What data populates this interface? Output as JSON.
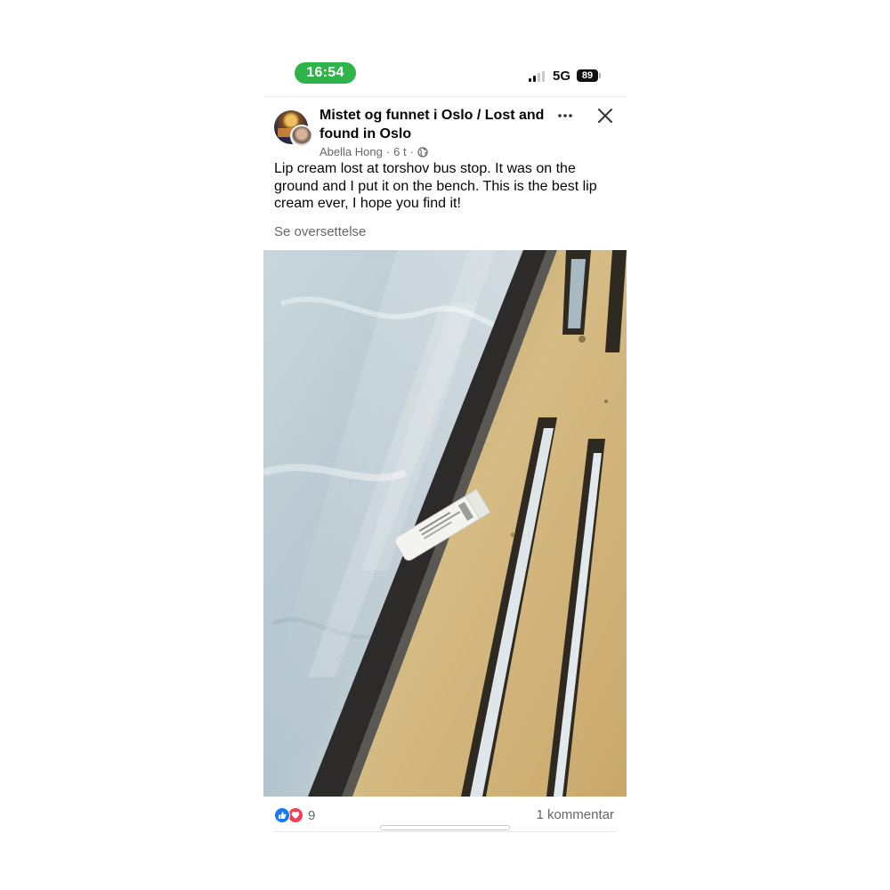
{
  "status_bar": {
    "time": "16:54",
    "network": "5G",
    "battery": "89"
  },
  "post": {
    "group_name": "Mistet og funnet i Oslo / Lost and found in Oslo",
    "author": "Abella Hong",
    "time_ago": "6 t",
    "meta_separator": "·",
    "text": "Lip cream lost at torshov bus stop. It was on the ground and I put it on the bench. This is the best lip cream ever, I hope you find it!",
    "translate_label": "Se oversettelse"
  },
  "footer": {
    "reaction_count": "9",
    "comment_count": "1 kommentar"
  },
  "icons": {
    "like": "like-icon",
    "love": "love-icon",
    "more": "more-options-icon",
    "close": "close-icon",
    "audience": "globe-icon"
  },
  "colors": {
    "time_pill": "#2fb44a",
    "like": "#1877f2",
    "love": "#f33e58",
    "secondary_text": "#65676b"
  }
}
